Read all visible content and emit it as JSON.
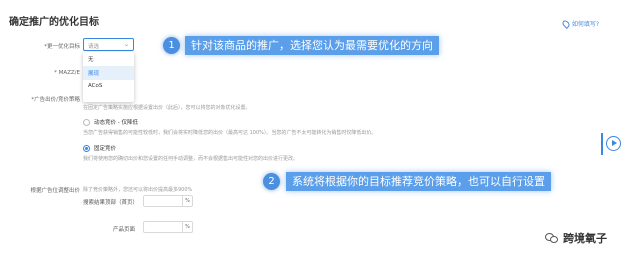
{
  "header": {
    "title": "确定推广的优化目标",
    "help_link": "如何填写?"
  },
  "form": {
    "goal_label": "*更一优化目标",
    "select_value": "请选",
    "dropdown_options": [
      "无",
      "展现",
      "ACoS"
    ],
    "maxbid_label": "* MAZZ/E",
    "strategy_label": "*广告出价/竞价策略",
    "strategy_desc_top": "在固定广告策略实施应根据设置出价（此后），您可以将您的对象优化设置。",
    "options": [
      {
        "label": "动态竞价 - 仅降低",
        "desc": "当您广告获得销售的可能性较低时，我们会将实时降低您的出价（最高可达 100%）。当您的广告不太可能转化为销售时仅降低出价。",
        "selected": false
      },
      {
        "label": "固定竞价",
        "desc": "我们将使用您的确切出价和您设置的任何手动调整，而不会根据售出可能性对您的出价进行更改。",
        "selected": true
      }
    ],
    "placement_label": "根据广告位调整出价",
    "placement_desc": "除了竞价策略外，您还可以将出价提高最多900%",
    "top_label": "搜索结果顶部（首页）",
    "product_label": "产品页面",
    "unit": "%"
  },
  "callouts": [
    {
      "number": "1",
      "text": "针对该商品的推广，选择您认为最需要优化的方向"
    },
    {
      "number": "2",
      "text": "系统将根据你的目标推荐竞价策略，也可以自行设置"
    }
  ],
  "watermark": {
    "text": "跨境氧子"
  },
  "colors": {
    "accent": "#3a86e0",
    "callout": "#5b9ee9",
    "required": "#e34d4d"
  }
}
